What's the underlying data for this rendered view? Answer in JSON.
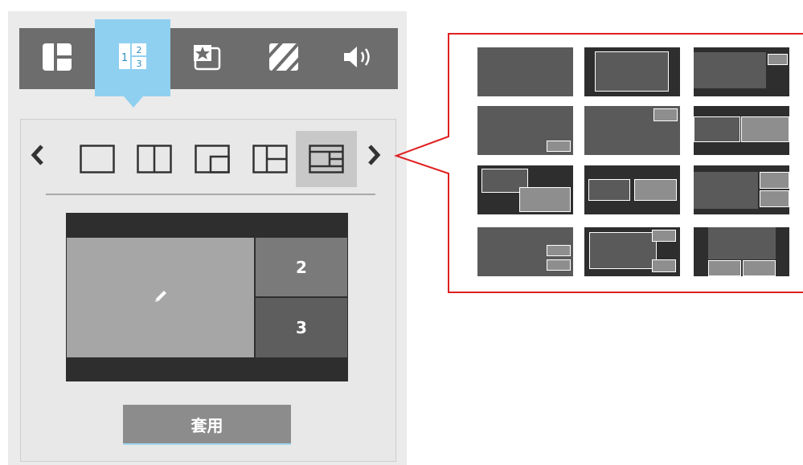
{
  "toolbar": {
    "buttons": [
      {
        "name": "layout-tab",
        "icon": "layout-grid-icon",
        "active": false
      },
      {
        "name": "numbered-layout-tab",
        "icon": "numbered-split-icon",
        "active": true,
        "digits": [
          "1",
          "2",
          "3"
        ]
      },
      {
        "name": "picture-tab",
        "icon": "star-picture-icon",
        "active": false
      },
      {
        "name": "background-tab",
        "icon": "stripes-icon",
        "active": false
      },
      {
        "name": "audio-tab",
        "icon": "speaker-icon",
        "active": false
      }
    ]
  },
  "layout_selector": {
    "prev_arrow": "‹",
    "next_arrow": "›",
    "options": [
      "single",
      "two-column",
      "picture-in-picture",
      "main-with-right-split",
      "top-bottom-bars"
    ],
    "selected_index": 4
  },
  "preview": {
    "main_icon": "pencil-icon",
    "cells": [
      {
        "label": "2",
        "color": "#7a7a7a"
      },
      {
        "label": "3",
        "color": "#5e5e5e"
      }
    ]
  },
  "apply_button": {
    "label": "套用"
  },
  "colors": {
    "accent": "#8fd0f1",
    "callout_border": "#e02020",
    "toolbar": "#6d6d6d",
    "tile_dark": "#2e2e2e",
    "tile_mid": "#5a5a5a",
    "tile_light": "#8e8e8e"
  },
  "layout_gallery": {
    "tiles": [
      "full",
      "letterbox-box",
      "pip-top-right-dark",
      "pip-bottom-right",
      "pip-top-right-light",
      "split-with-bars",
      "overlap-diagonal",
      "two-boxes-dark",
      "main-right-stack",
      "two-small-bottom-right",
      "box-with-two-corners",
      "main-top-two-bottom"
    ]
  }
}
